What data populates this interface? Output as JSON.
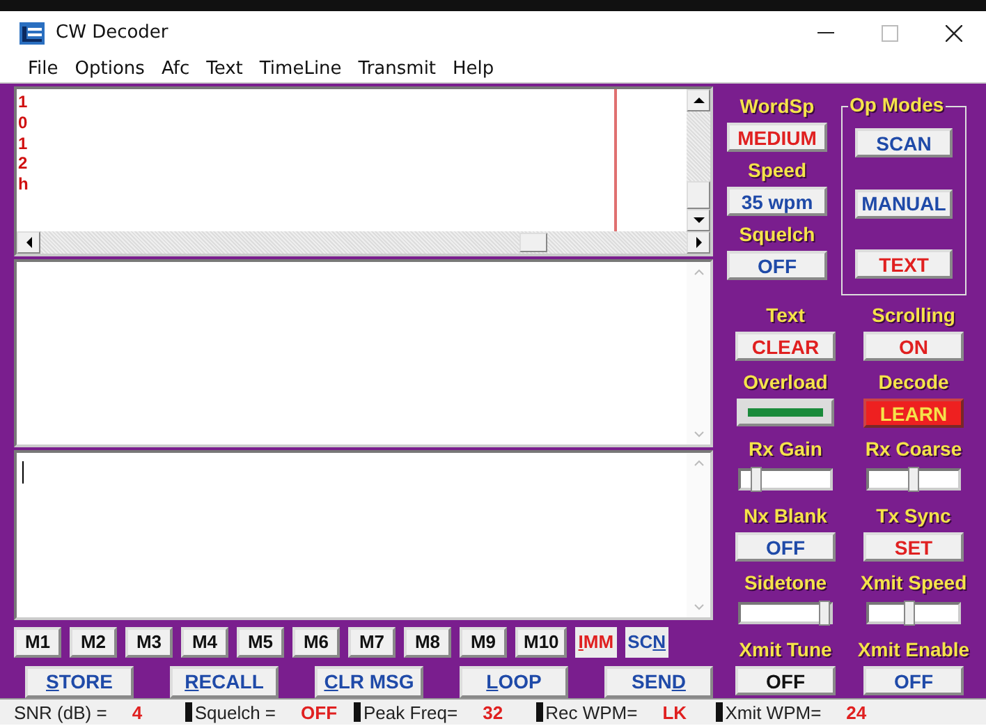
{
  "window": {
    "title": "CW Decoder"
  },
  "menu": [
    "File",
    "Options",
    "Afc",
    "Text",
    "TimeLine",
    "Transmit",
    "Help"
  ],
  "decode_pane": {
    "lines": [
      "1",
      "0",
      "1",
      "2",
      "h"
    ]
  },
  "left_controls": [
    {
      "label": "WordSp",
      "button": "MEDIUM",
      "color": "#e02020"
    },
    {
      "label": "Speed",
      "button": "35 wpm",
      "color": "#1f4aa8"
    },
    {
      "label": "Squelch",
      "button": "OFF",
      "color": "#1f4aa8"
    }
  ],
  "op_modes": {
    "title": "Op Modes",
    "buttons": [
      {
        "label": "SCAN",
        "color": "#1f4aa8"
      },
      {
        "label": "MANUAL",
        "color": "#1f4aa8"
      },
      {
        "label": "TEXT",
        "color": "#e02020"
      }
    ]
  },
  "controls": [
    {
      "label": "Text",
      "kind": "button",
      "text": "CLEAR",
      "color": "#e02020",
      "highlighted": false
    },
    {
      "label": "Scrolling",
      "kind": "button",
      "text": "ON",
      "color": "#e02020",
      "highlighted": false
    },
    {
      "label": "Overload",
      "kind": "indicator"
    },
    {
      "label": "Decode",
      "kind": "button",
      "text": "LEARN",
      "highlighted": true
    },
    {
      "label": "Rx Gain",
      "kind": "slider",
      "level": 0.12
    },
    {
      "label": "Rx Coarse",
      "kind": "slider",
      "level": 0.5
    },
    {
      "label": "Nx Blank",
      "kind": "button",
      "text": "OFF",
      "color": "#1f4aa8",
      "highlighted": false
    },
    {
      "label": "Tx Sync",
      "kind": "button",
      "text": "SET",
      "color": "#e02020",
      "highlighted": false
    },
    {
      "label": "Sidetone",
      "kind": "slider",
      "level": 1.0
    },
    {
      "label": "Xmit Speed",
      "kind": "slider",
      "level": 0.45
    },
    {
      "label": "Xmit Tune",
      "kind": "button",
      "text": "OFF",
      "color": "#111111",
      "highlighted": false
    },
    {
      "label": "Xmit Enable",
      "kind": "button",
      "text": "OFF",
      "color": "#1f4aa8",
      "highlighted": false
    }
  ],
  "memory_buttons": [
    {
      "before": "M1",
      "color": "#111111"
    },
    {
      "before": "M2",
      "color": "#111111"
    },
    {
      "before": "M3",
      "color": "#111111"
    },
    {
      "before": "M4",
      "color": "#111111"
    },
    {
      "before": "M5",
      "color": "#111111"
    },
    {
      "before": "M6",
      "color": "#111111"
    },
    {
      "before": "M7",
      "color": "#111111"
    },
    {
      "before": "M8",
      "color": "#111111"
    },
    {
      "before": "M9",
      "color": "#111111"
    },
    {
      "before": "M10",
      "color": "#111111"
    },
    {
      "key": "I",
      "after": "MM",
      "color": "#e02020"
    },
    {
      "before": "SC",
      "key": "N",
      "color": "#1f4aa8"
    }
  ],
  "action_buttons": [
    {
      "key": "S",
      "after": "TORE"
    },
    {
      "key": "R",
      "after": "ECALL"
    },
    {
      "key": "C",
      "after": "LR MSG"
    },
    {
      "key": "L",
      "after": "OOP"
    },
    {
      "before": "SEN",
      "key": "D"
    }
  ],
  "status_bar": [
    {
      "label": "SNR (dB) =",
      "value": "4"
    },
    {
      "label": "Squelch =",
      "value": "OFF"
    },
    {
      "label": "Peak Freq=",
      "value": "32"
    },
    {
      "label": "Rec WPM=",
      "value": "LK"
    },
    {
      "label": "Xmit WPM=",
      "value": "24"
    }
  ]
}
